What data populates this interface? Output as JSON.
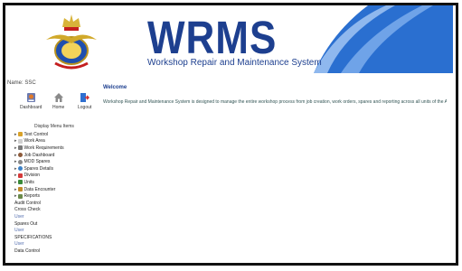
{
  "app": {
    "logo_text": "WRMS",
    "subtitle": "Workshop Repair and Maintenance System"
  },
  "user": {
    "label": "Name: SSC"
  },
  "toolbar": {
    "buttons": [
      {
        "label": "Dashboard",
        "icon": "dashboard-icon"
      },
      {
        "label": "Home",
        "icon": "home-icon"
      },
      {
        "label": "Logout",
        "icon": "logout-icon"
      }
    ]
  },
  "welcome": {
    "title": "Welcome",
    "text": "Workshop Repair and Maintenance System is designed to manage the entire workshop process from job creation, work orders, spares and reporting across all units of the Air Force."
  },
  "tree": {
    "title": "Display Menu Items",
    "items": [
      {
        "label": "Text Control",
        "icon": "folder-icon"
      },
      {
        "label": "Work Area",
        "icon": "page-icon"
      },
      {
        "label": "Work Requirements",
        "icon": "list-icon"
      },
      {
        "label": "Job Dashboard",
        "icon": "clock-icon"
      },
      {
        "label": "MOD Spares",
        "icon": "gear-icon"
      },
      {
        "label": "Spares Details",
        "icon": "globe-icon"
      },
      {
        "label": "Division",
        "icon": "flag-icon"
      },
      {
        "label": "Units",
        "icon": "user-icon"
      },
      {
        "label": "Data Encounter",
        "icon": "database-icon"
      },
      {
        "label": "Reports",
        "icon": "report-icon"
      },
      {
        "label": "Audit Control",
        "icon": ""
      },
      {
        "label": "Cross Check",
        "icon": ""
      },
      {
        "label": "User",
        "icon": ""
      },
      {
        "label": "Spares Out",
        "icon": ""
      },
      {
        "label": "User",
        "icon": ""
      },
      {
        "label": "SPECIFICATIONS",
        "icon": ""
      },
      {
        "label": "User",
        "icon": ""
      },
      {
        "label": "Data Control",
        "icon": ""
      }
    ]
  },
  "colors": {
    "banner_blue": "#2a6fd0",
    "title_navy": "#1d3f8f"
  }
}
